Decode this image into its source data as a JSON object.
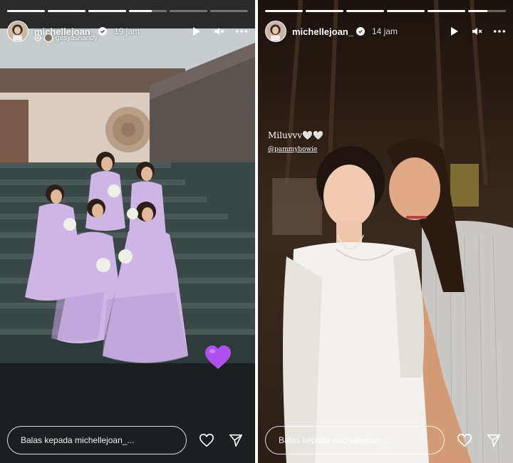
{
  "stories": [
    {
      "id": "left",
      "username": "michellejoan_",
      "time": "19 jam",
      "mention_tag": "gesyashandy",
      "reply_placeholder": "Balas kepada michellejoan_...",
      "progress": [
        1,
        1,
        1,
        0.6,
        0,
        0
      ],
      "sticker": "purple-heart",
      "icons": [
        "play-icon",
        "mute-icon",
        "more-icon",
        "heart-icon",
        "send-icon"
      ]
    },
    {
      "id": "right",
      "username": "michellejoan_",
      "time": "14 jam",
      "caption": "Miluvvv🤍🤍",
      "mention": "@pammybowie",
      "reply_placeholder": "Balas kepada michellejoan_...",
      "progress": [
        1,
        1,
        1,
        1,
        1,
        0.5
      ],
      "icons": [
        "play-icon",
        "mute-icon",
        "more-icon",
        "heart-icon",
        "send-icon"
      ]
    }
  ],
  "colors": {
    "dress": "#cdb6e6",
    "stairs": "#3d4a4a",
    "heart": "#b050f0",
    "white_dress": "#f3f1ee"
  }
}
